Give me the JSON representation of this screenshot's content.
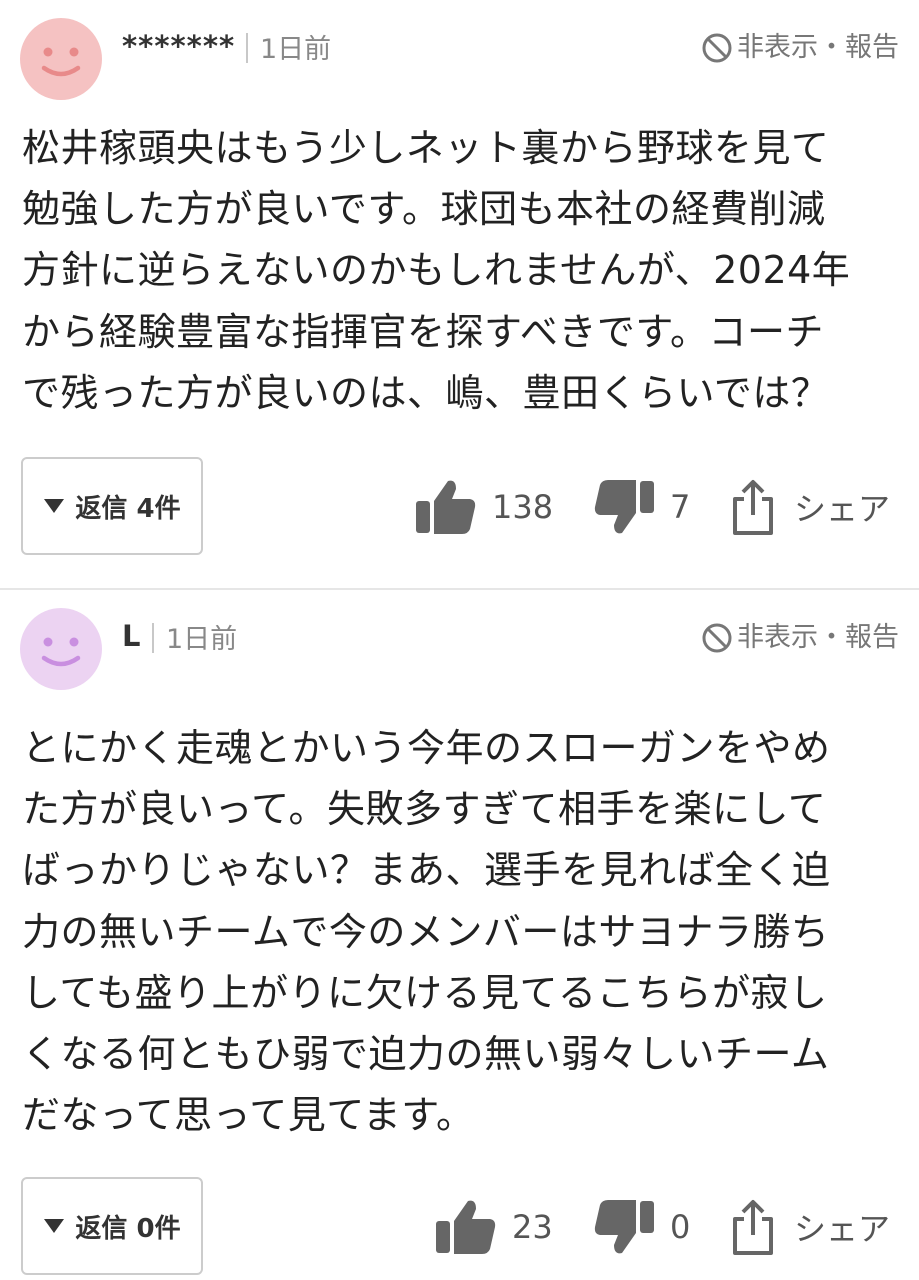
{
  "comments": [
    {
      "username": "*******",
      "date": "1日前",
      "hide_report": "非表示・報告",
      "avatar_color": "#f5c2c2",
      "face_color": "#e88a8a",
      "lines": [
        "松井稼頭央はもう少しネット裏から野球を見て",
        "勉強した方が良いです。球団も本社の経費削減",
        "方針に逆らえないのかもしれませんが、2024年",
        "から経験豊富な指揮官を探すべきです。コーチ",
        "で残った方が良いのは、嶋、豊田くらいでは？"
      ],
      "reply_label": "返信 4件",
      "likes": "138",
      "dislikes": "7",
      "share_label": "シェア"
    },
    {
      "username": "L",
      "date": "1日前",
      "hide_report": "非表示・報告",
      "avatar_color": "#ecd3f2",
      "face_color": "#c98fe0",
      "lines": [
        "とにかく走魂とかいう今年のスローガンをやめ",
        "た方が良いって。失敗多すぎて相手を楽にして",
        "ばっかりじゃない？まあ、選手を見れば全く迫",
        "力の無いチームで今のメンバーはサヨナラ勝ち",
        "しても盛り上がりに欠ける見てるこちらが寂し",
        "くなる何ともひ弱で迫力の無い弱々しいチーム",
        "だなって思って見てます。"
      ],
      "reply_label": "返信 0件",
      "likes": "23",
      "dislikes": "0",
      "share_label": "シェア"
    }
  ],
  "colors": {
    "text": "#222222",
    "muted": "#888888",
    "icon": "#666666",
    "divider": "#e6e6e6"
  },
  "icons": {
    "hide": "no-entry-icon",
    "like": "thumbs-up-icon",
    "dislike": "thumbs-down-icon",
    "share": "share-icon",
    "reply": "triangle-down-icon"
  }
}
